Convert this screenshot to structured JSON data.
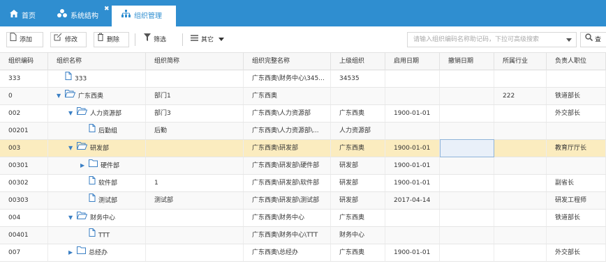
{
  "tabs": [
    {
      "label": "首页",
      "icon": "home-icon"
    },
    {
      "label": "系统结构",
      "icon": "sitemap-icon"
    },
    {
      "label": "组织管理",
      "icon": "org-icon"
    }
  ],
  "toolbar": {
    "add": "添加",
    "edit": "修改",
    "delete": "删除",
    "filter": "筛选",
    "other": "其它",
    "search_placeholder": "请输入组织编码名称助记码，下拉可高级搜索",
    "search": "查"
  },
  "columns": [
    "组织编码",
    "组织名称",
    "组织简称",
    "组织完整名称",
    "上级组织",
    "启用日期",
    "撤销日期",
    "所属行业",
    "负责人职位"
  ],
  "rows": [
    {
      "code": "333",
      "name": "333",
      "short": "",
      "full": "广东西奥\\财务中心\\345...",
      "parent": "34535",
      "start": "",
      "end": "",
      "industry": "",
      "pos": ""
    },
    {
      "code": "0",
      "name": "广东西奥",
      "short": "部门1",
      "full": "广东西奥",
      "parent": "",
      "start": "",
      "end": "",
      "industry": "222",
      "pos": "铁道部长"
    },
    {
      "code": "002",
      "name": "人力资源部",
      "short": "部门3",
      "full": "广东西奥\\人力资源部",
      "parent": "广东西奥",
      "start": "1900-01-01",
      "end": "",
      "industry": "",
      "pos": "外交部长"
    },
    {
      "code": "00201",
      "name": "后勤组",
      "short": "后勤",
      "full": "广东西奥\\人力资源部\\...",
      "parent": "人力资源部",
      "start": "",
      "end": "",
      "industry": "",
      "pos": ""
    },
    {
      "code": "003",
      "name": "研发部",
      "short": "",
      "full": "广东西奥\\研发部",
      "parent": "广东西奥",
      "start": "1900-01-01",
      "end": "",
      "industry": "",
      "pos": "教育厅厅长"
    },
    {
      "code": "00301",
      "name": "硬件部",
      "short": "",
      "full": "广东西奥\\研发部\\硬件部",
      "parent": "研发部",
      "start": "1900-01-01",
      "end": "",
      "industry": "",
      "pos": ""
    },
    {
      "code": "00302",
      "name": "软件部",
      "short": "1",
      "full": "广东西奥\\研发部\\软件部",
      "parent": "研发部",
      "start": "1900-01-01",
      "end": "",
      "industry": "",
      "pos": "副省长"
    },
    {
      "code": "00303",
      "name": "测试部",
      "short": "测试部",
      "full": "广东西奥\\研发部\\测试部",
      "parent": "研发部",
      "start": "2017-04-14",
      "end": "",
      "industry": "",
      "pos": "研发工程师"
    },
    {
      "code": "004",
      "name": "财务中心",
      "short": "",
      "full": "广东西奥\\财务中心",
      "parent": "广东西奥",
      "start": "",
      "end": "",
      "industry": "",
      "pos": "铁道部长"
    },
    {
      "code": "00401",
      "name": "TTT",
      "short": "",
      "full": "广东西奥\\财务中心\\TTT",
      "parent": "财务中心",
      "start": "",
      "end": "",
      "industry": "",
      "pos": ""
    },
    {
      "code": "007",
      "name": "总经办",
      "short": "",
      "full": "广东西奥\\总经办",
      "parent": "广东西奥",
      "start": "1900-01-01",
      "end": "",
      "industry": "",
      "pos": "外交部长"
    }
  ]
}
